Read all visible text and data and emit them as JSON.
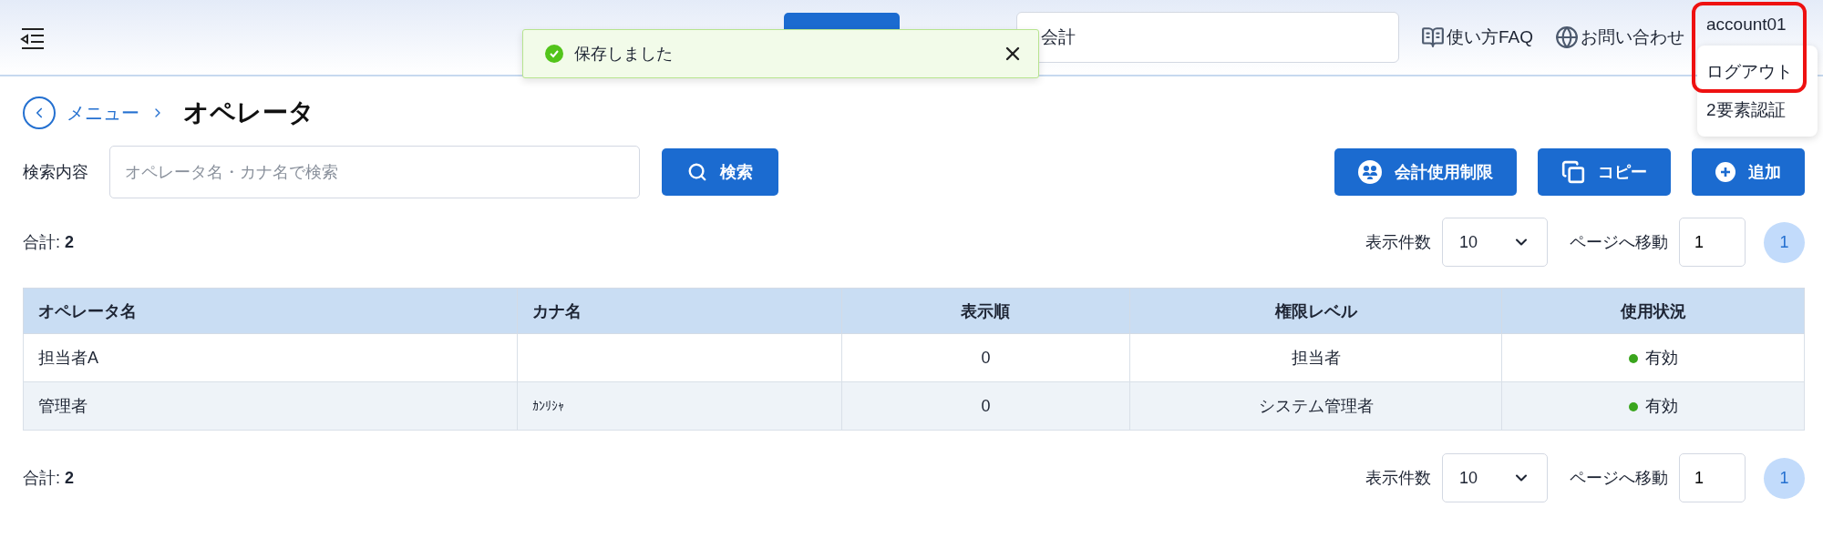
{
  "header": {
    "fiscal_field": {
      "value": "会計"
    },
    "links": [
      {
        "kind": "book",
        "label": "使い方FAQ"
      },
      {
        "kind": "globe",
        "label": "お問い合わせ"
      }
    ],
    "account": {
      "name": "account01",
      "highlighted": true,
      "menu": [
        {
          "label": "ログアウト"
        },
        {
          "label": "2要素認証"
        }
      ]
    }
  },
  "toast": {
    "message": "保存しました"
  },
  "breadcrumb": {
    "back": "メニュー",
    "title": "オペレータ"
  },
  "search": {
    "label": "検索内容",
    "placeholder": "オペレータ名・カナ名で検索",
    "button": "検索"
  },
  "actions": [
    {
      "kind": "restrict",
      "label": "会計使用制限"
    },
    {
      "kind": "copy",
      "label": "コピー"
    },
    {
      "kind": "add",
      "label": "追加"
    }
  ],
  "pager_top": {
    "total_label": "合計:",
    "total": "2",
    "per_page_label": "表示件数",
    "per_page": "10",
    "goto_label": "ページへ移動",
    "goto": "1",
    "pages": [
      {
        "label": "1",
        "selected": true
      }
    ]
  },
  "table": {
    "columns": [
      "オペレータ名",
      "カナ名",
      "表示順",
      "権限レベル",
      "使用状況"
    ],
    "rows": [
      {
        "name": "担当者A",
        "order": "0",
        "role": "担当者",
        "status": "有効",
        "color": "#3aa51d"
      },
      {
        "name": "管理者",
        "kana": "ｶﾝﾘｼｬ",
        "order": "0",
        "role": "システム管理者",
        "status": "有効",
        "color": "#3aa51d"
      }
    ]
  },
  "pager_bottom": {
    "total_label": "合計:",
    "total": "2",
    "per_page_label": "表示件数",
    "per_page": "10",
    "goto_label": "ページへ移動",
    "goto": "1",
    "pages": [
      {
        "label": "1",
        "selected": true
      }
    ]
  }
}
